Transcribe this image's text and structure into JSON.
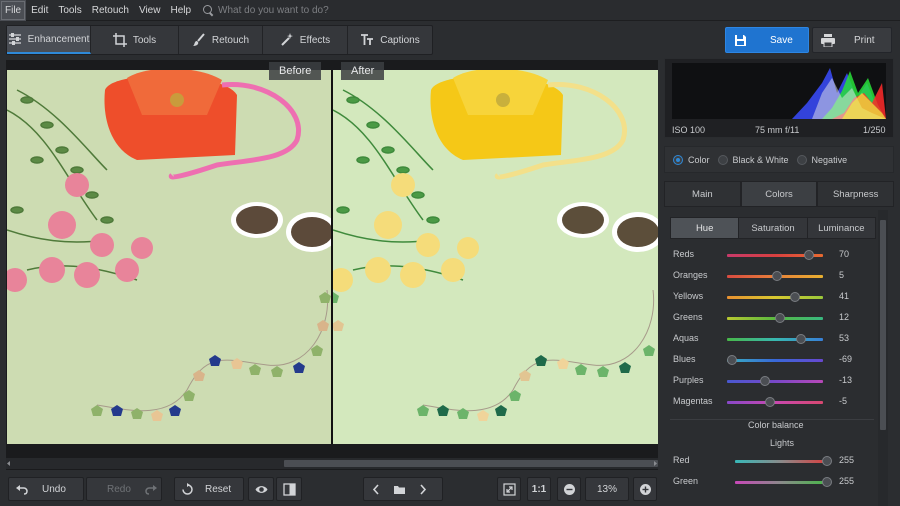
{
  "menu": {
    "items": [
      "File",
      "Edit",
      "Tools",
      "Retouch",
      "View",
      "Help"
    ],
    "search_placeholder": "What do you want to do?"
  },
  "tabs": [
    {
      "label": "Enhancement",
      "icon": "sliders-icon"
    },
    {
      "label": "Tools",
      "icon": "crop-icon"
    },
    {
      "label": "Retouch",
      "icon": "brush-icon"
    },
    {
      "label": "Effects",
      "icon": "magic-wand-icon"
    },
    {
      "label": "Captions",
      "icon": "text-icon"
    }
  ],
  "actions": {
    "save": "Save",
    "print": "Print"
  },
  "photo": {
    "before_label": "Before",
    "after_label": "After"
  },
  "bottom": {
    "undo": "Undo",
    "redo": "Redo",
    "reset": "Reset",
    "ratio": "1:1",
    "zoom": "13%"
  },
  "histogram": {
    "iso": "ISO 100",
    "lens": "75 mm f/11",
    "shutter": "1/250"
  },
  "color_mode": {
    "options": [
      "Color",
      "Black & White",
      "Negative"
    ],
    "selected": "Color"
  },
  "panel_tabs": {
    "items": [
      "Main",
      "Colors",
      "Sharpness"
    ],
    "active": "Colors"
  },
  "sub_tabs": {
    "items": [
      "Hue",
      "Saturation",
      "Luminance"
    ],
    "active": "Hue"
  },
  "hue_sliders": [
    {
      "label": "Reds",
      "value": "70",
      "level": 0.85
    },
    {
      "label": "Oranges",
      "value": "5",
      "level": 0.52
    },
    {
      "label": "Yellows",
      "value": "41",
      "level": 0.71
    },
    {
      "label": "Greens",
      "value": "12",
      "level": 0.55
    },
    {
      "label": "Aquas",
      "value": "53",
      "level": 0.77
    },
    {
      "label": "Blues",
      "value": "-69",
      "level": 0.05
    },
    {
      "label": "Purples",
      "value": "-13",
      "level": 0.4
    },
    {
      "label": "Magentas",
      "value": "-5",
      "level": 0.45
    }
  ],
  "color_balance": {
    "title": "Color balance",
    "subtitle": "Lights",
    "sliders": [
      {
        "label": "Red",
        "value": "255",
        "level": 1.0
      },
      {
        "label": "Green",
        "value": "255",
        "level": 1.0
      }
    ]
  },
  "colors": {
    "accent": "#2e89d8",
    "save_button": "#1f74d0"
  }
}
